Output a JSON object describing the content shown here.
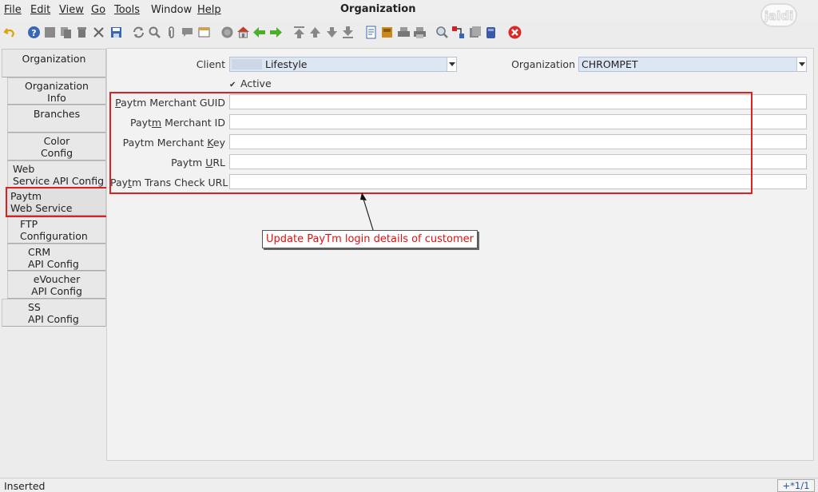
{
  "menu": {
    "file": "File",
    "edit": "Edit",
    "view": "View",
    "go": "Go",
    "tools": "Tools",
    "window": "Window",
    "help": "Help"
  },
  "window_title": "Organization",
  "logo_text": "jaldi",
  "toolbar_icons": [
    "undo-icon",
    "help-icon",
    "new-icon",
    "copy-icon",
    "delete-icon",
    "delete-selection-icon",
    "save-icon",
    "refresh-icon",
    "find-icon",
    "attachment-icon",
    "chat-icon",
    "grid-toggle-icon",
    "history-icon",
    "home-icon",
    "back-icon",
    "forward-icon",
    "first-record-icon",
    "previous-record-icon",
    "next-record-icon",
    "last-record-icon",
    "report-icon",
    "archive-icon",
    "print-preview-icon",
    "print-icon",
    "zoom-across-icon",
    "active-workflows-icon",
    "requests-icon",
    "product-info-icon",
    "exit-icon"
  ],
  "tabs": [
    {
      "line1": "Organization",
      "line2": ""
    },
    {
      "line1": "Organization",
      "line2": "Info"
    },
    {
      "line1": "Branches",
      "line2": ""
    },
    {
      "line1": "Color",
      "line2": "Config"
    },
    {
      "line1": "Web",
      "line2": "Service API Config"
    },
    {
      "line1": "Paytm",
      "line2": "Web Service Config"
    },
    {
      "line1": "FTP",
      "line2": "Configuration"
    },
    {
      "line1": "CRM",
      "line2": "API Config"
    },
    {
      "line1": "eVoucher",
      "line2": "API Config"
    },
    {
      "line1": "SS",
      "line2": "API Config"
    }
  ],
  "form": {
    "client_label": "Client",
    "client_value": "Lifestyle",
    "organization_label": "Organization",
    "organization_value": "CHROMPET",
    "active_label": "Active",
    "active_checked": true,
    "fields": [
      {
        "label_pre": "",
        "label_u": "P",
        "label_post": "aytm Merchant GUID",
        "value": ""
      },
      {
        "label_pre": "Payt",
        "label_u": "m",
        "label_post": " Merchant ID",
        "value": ""
      },
      {
        "label_pre": "Paytm Merchant ",
        "label_u": "K",
        "label_post": "ey",
        "value": ""
      },
      {
        "label_pre": "Paytm ",
        "label_u": "U",
        "label_post": "RL",
        "value": ""
      },
      {
        "label_pre": "Pay",
        "label_u": "t",
        "label_post": "m Trans Check URL",
        "value": ""
      }
    ]
  },
  "annotation": {
    "text": "Update PayTm login details of customer"
  },
  "status": {
    "text": "Inserted",
    "record": "+*1/1"
  },
  "colors": {
    "highlight_red": "#e02020",
    "select_bg": "#dde6f3"
  }
}
